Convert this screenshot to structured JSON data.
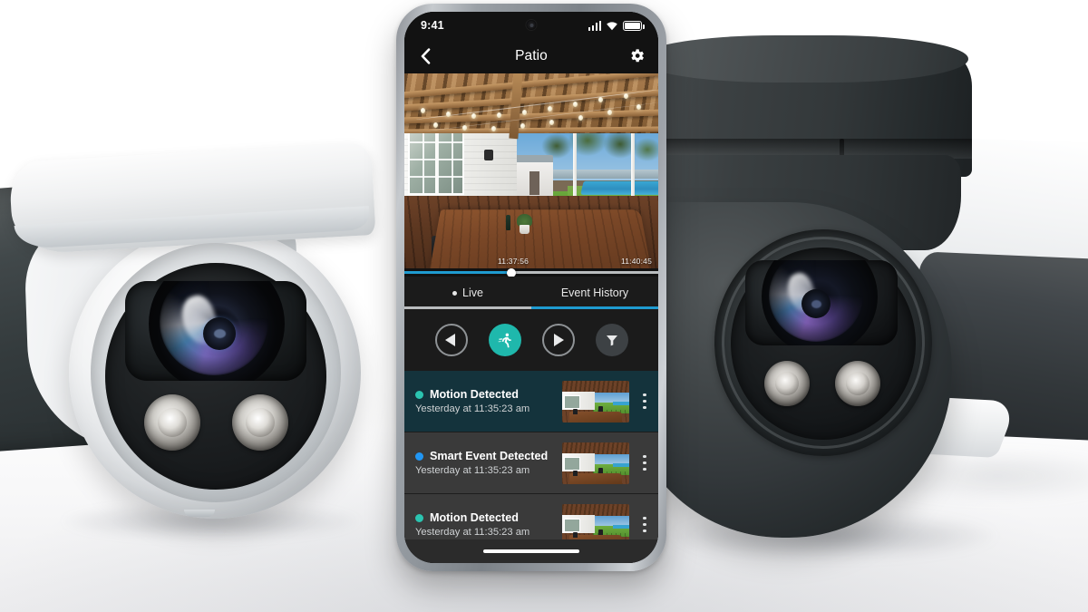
{
  "phone": {
    "status_bar": {
      "time": "9:41",
      "icons": [
        "signal-icon",
        "wifi-icon",
        "battery-icon"
      ]
    },
    "header": {
      "back_icon": "chevron-left-icon",
      "title": "Patio",
      "settings_icon": "gear-icon"
    },
    "video": {
      "scene_description": "Covered patio with wooden pergola, string lights, dining table, lawn and pool",
      "timestamp_left": "11:37:56",
      "timestamp_right": "11:40:45",
      "scrubber_position_percent": 42
    },
    "tabs": [
      {
        "label": "Live",
        "active": false,
        "has_dot": true
      },
      {
        "label": "Event History",
        "active": true,
        "has_dot": false
      }
    ],
    "controls": [
      {
        "name": "previous-event-button",
        "icon": "triangle-left-icon"
      },
      {
        "name": "motion-filter-button",
        "icon": "running-person-icon",
        "active": true
      },
      {
        "name": "next-event-button",
        "icon": "triangle-right-icon"
      },
      {
        "name": "filter-button",
        "icon": "funnel-icon"
      }
    ],
    "events": [
      {
        "title": "Motion Detected",
        "subtitle": "Yesterday at 11:35:23 am",
        "dot_color": "#2bc4b0",
        "selected": true,
        "menu_icon": "kebab-menu-icon"
      },
      {
        "title": "Smart Event Detected",
        "subtitle": "Yesterday at 11:35:23 am",
        "dot_color": "#2196f3",
        "selected": false,
        "menu_icon": "kebab-menu-icon"
      },
      {
        "title": "Motion Detected",
        "subtitle": "Yesterday at 11:35:23 am",
        "dot_color": "#2bc4b0",
        "selected": false,
        "menu_icon": "kebab-menu-icon"
      }
    ],
    "home_indicator": true
  },
  "products": {
    "left_camera": {
      "name": "white-turret-dome-camera",
      "color": "#f2f3f4"
    },
    "right_camera": {
      "name": "black-ptz-dome-camera",
      "color": "#33383a"
    },
    "background_cameras": [
      {
        "name": "dark-bullet-camera-left",
        "color": "#343b3d"
      },
      {
        "name": "white-bullet-camera-right",
        "color": "#f4f5f6"
      }
    ]
  },
  "colors": {
    "accent_teal": "#1fb8ac",
    "accent_blue": "#1f9bd0",
    "selected_row": "#14333c",
    "row": "#3a3a3a",
    "app_bar": "#121212"
  }
}
